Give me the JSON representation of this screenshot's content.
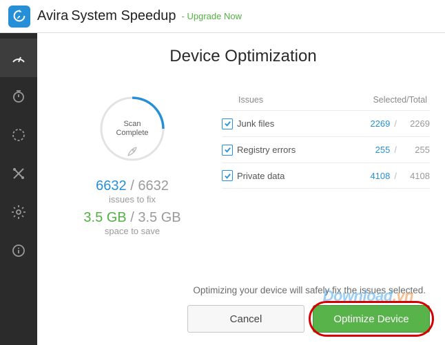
{
  "header": {
    "title_avira": "Avira",
    "title_rest": "System Speedup",
    "upgrade": "- Upgrade Now"
  },
  "page": {
    "title": "Device Optimization"
  },
  "scan": {
    "status_line1": "Scan",
    "status_line2": "Complete",
    "issues_found": "6632",
    "issues_total": "6632",
    "issues_label": "issues to fix",
    "space_found": "3.5 GB",
    "space_total": "3.5 GB",
    "space_label": "space to save"
  },
  "issues_header": {
    "issues": "Issues",
    "selected_total": "Selected/Total"
  },
  "issues": [
    {
      "name": "Junk files",
      "selected": "2269",
      "total": "2269"
    },
    {
      "name": "Registry errors",
      "selected": "255",
      "total": "255"
    },
    {
      "name": "Private data",
      "selected": "4108",
      "total": "4108"
    }
  ],
  "footer": {
    "note": "Optimizing your device will safely fix the issues selected.",
    "cancel": "Cancel",
    "optimize": "Optimize Device"
  },
  "watermark": {
    "a": "Download",
    "b": ".vn"
  }
}
